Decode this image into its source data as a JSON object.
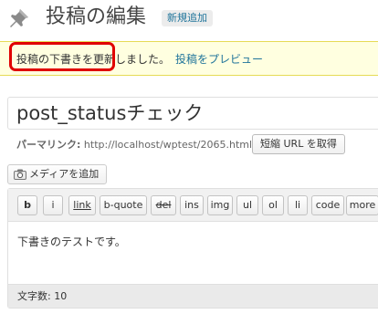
{
  "header": {
    "title": "投稿の編集",
    "add_new_label": "新規追加"
  },
  "notice": {
    "message": "投稿の下書きを更新しました。",
    "preview_link": "投稿をプレビュー"
  },
  "post": {
    "title": "post_statusチェック"
  },
  "permalink": {
    "label": "パーマリンク:",
    "url": "http://localhost/wptest/2065.html",
    "shortlink_button": "短縮 URL を取得"
  },
  "media": {
    "add_media_label": "メディアを追加"
  },
  "editor": {
    "toolbar": [
      "b",
      "i",
      "link",
      "b-quote",
      "del",
      "ins",
      "img",
      "ul",
      "ol",
      "li",
      "code",
      "more"
    ],
    "content": "下書きのテストです。"
  },
  "status_bar": {
    "word_count_label": "文字数:",
    "word_count_value": "10"
  },
  "icons": {
    "title_icon": "pushpin-icon",
    "media_icon": "media-camera-icon"
  },
  "colors": {
    "link": "#21759b",
    "notice_bg": "#ffffe0",
    "notice_border": "#e6db55",
    "highlight": "#e00000"
  }
}
